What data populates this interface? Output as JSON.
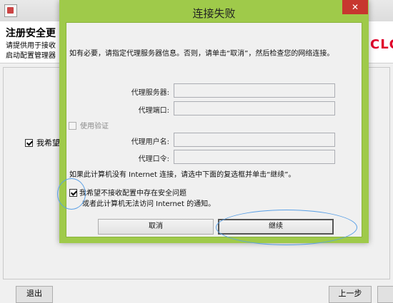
{
  "background_window": {
    "title": "注册安全更",
    "description_line1": "请提供用于接收",
    "description_line2": "启动配置管理器",
    "logo": "CLC",
    "checkbox_label": "我希望",
    "buttons": {
      "exit": "退出",
      "back": "上一步"
    }
  },
  "dialog": {
    "title": "连接失败",
    "close_glyph": "✕",
    "info_text": "如有必要，请指定代理服务器信息。否则，请单击“取消”，然后检查您的网络连接。",
    "fields": {
      "proxy_server_label": "代理服务器:",
      "proxy_port_label": "代理端口:",
      "proxy_user_label": "代理用户名:",
      "proxy_password_label": "代理口令:",
      "proxy_server_value": "",
      "proxy_port_value": "",
      "proxy_user_value": "",
      "proxy_password_value": ""
    },
    "use_auth_label": "使用验证",
    "no_internet_hint": "如果此计算机没有 Internet 连接，请选中下面的复选框并单击“继续”。",
    "opt_out_line1": "我希望不接收配置中存在安全问题",
    "opt_out_line2": "或者此计算机无法访问 Internet 的通知。",
    "buttons": {
      "cancel": "取消",
      "continue": "继续"
    }
  },
  "colors": {
    "dialog_frame": "#9fca4a",
    "close_button": "#c7372f",
    "annotation_ring": "#5aa0e6",
    "logo": "#e0002a"
  }
}
